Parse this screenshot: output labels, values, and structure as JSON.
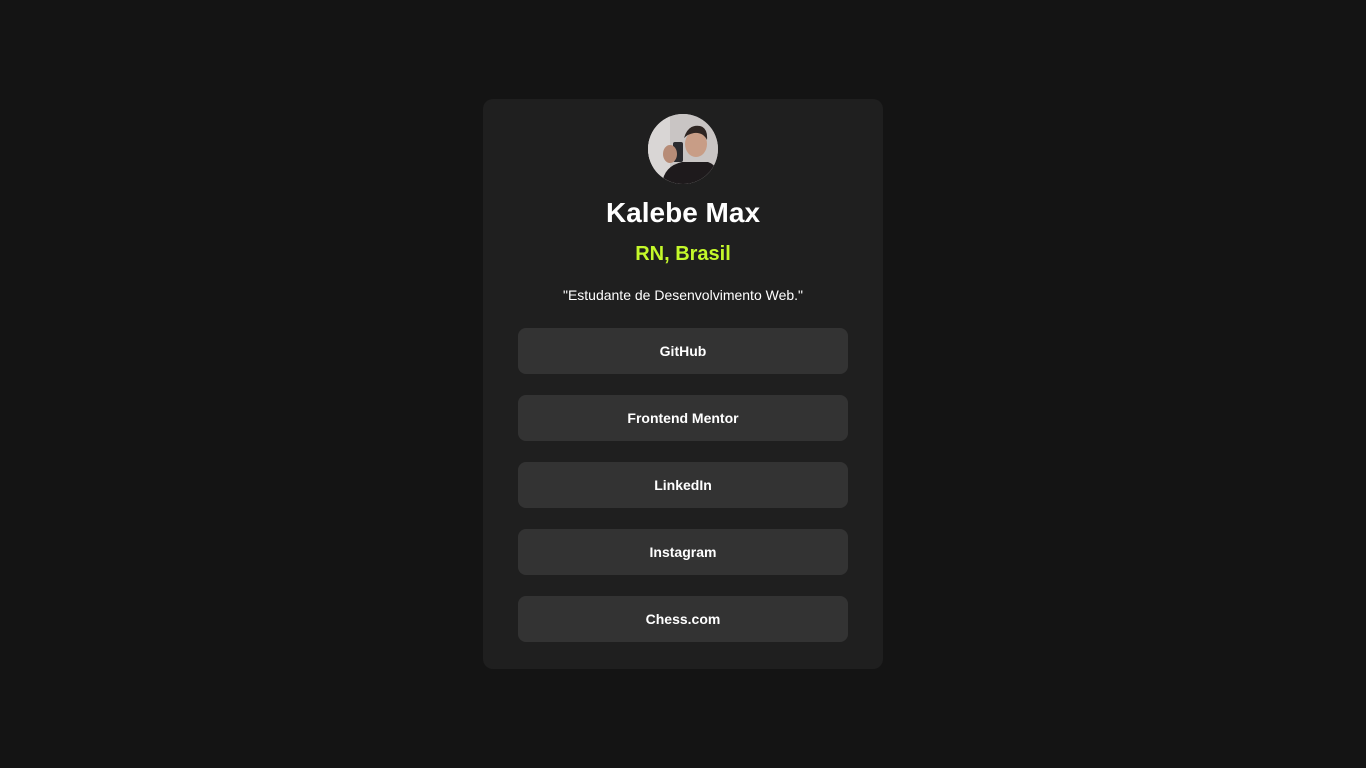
{
  "profile": {
    "avatar_icon": "profile-photo",
    "name": "Kalebe Max",
    "location": "RN, Brasil",
    "bio": "\"Estudante de Desenvolvimento Web.\""
  },
  "links": [
    {
      "label": "GitHub"
    },
    {
      "label": "Frontend Mentor"
    },
    {
      "label": "LinkedIn"
    },
    {
      "label": "Instagram"
    },
    {
      "label": "Chess.com"
    }
  ],
  "colors": {
    "background": "#141414",
    "card": "#1f1f1f",
    "button": "#333333",
    "accent": "#c4f82a",
    "text": "#ffffff"
  }
}
